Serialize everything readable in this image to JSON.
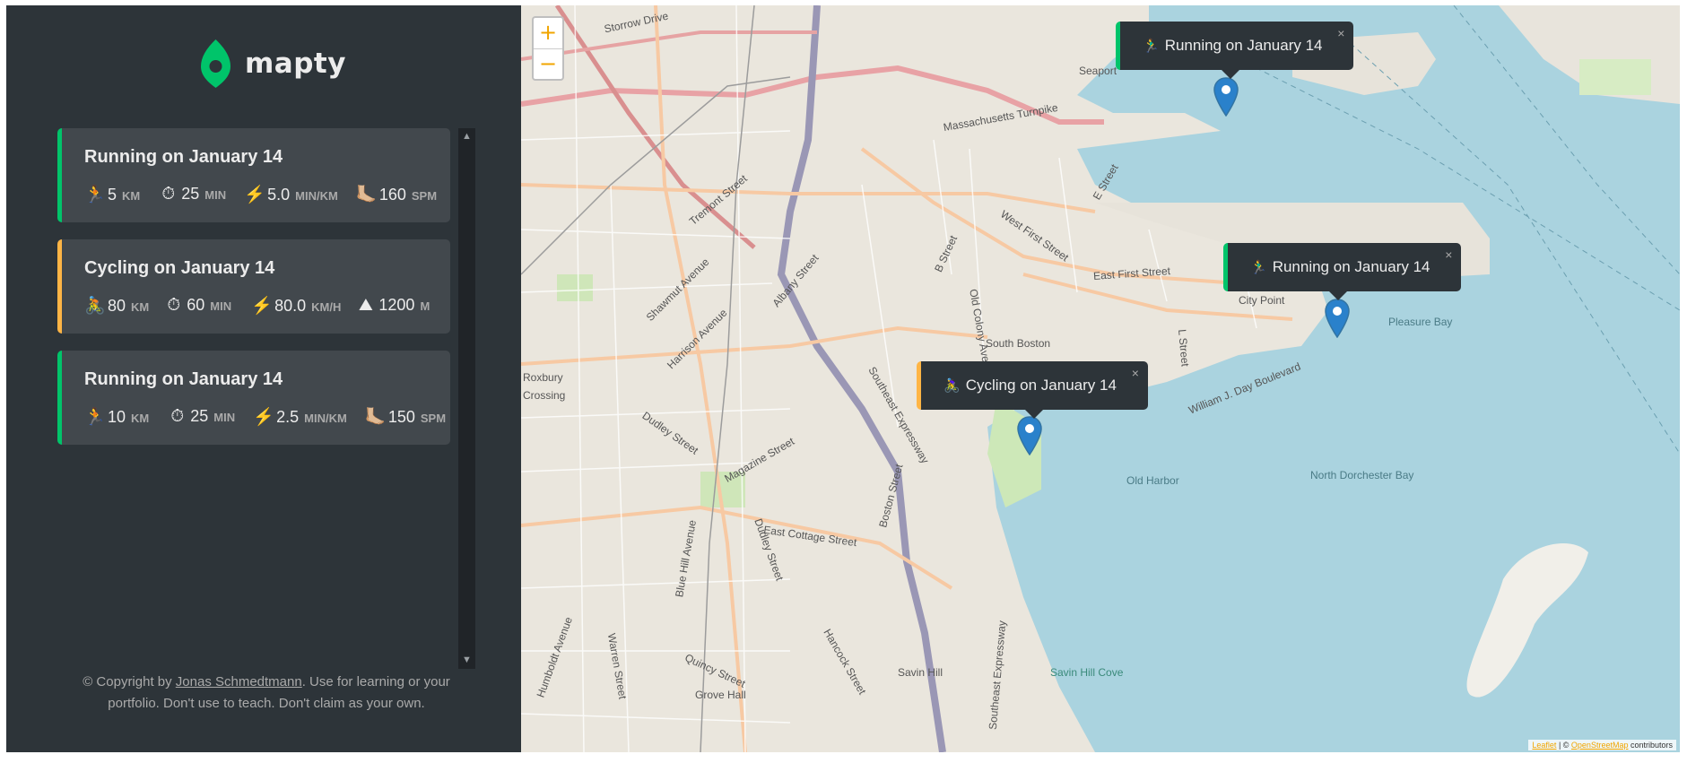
{
  "brand": {
    "name": "mapty",
    "accent": "#00c46a"
  },
  "colors": {
    "running": "#00c46a",
    "cycling": "#ffb545",
    "sidebar": "#2d3439",
    "card": "#42484d"
  },
  "workouts": [
    {
      "type": "running",
      "title": "Running on January 14",
      "stats": [
        {
          "icon": "🏃",
          "value": "5",
          "unit": "km"
        },
        {
          "icon": "⏱",
          "value": "25",
          "unit": "min"
        },
        {
          "icon": "⚡️",
          "value": "5.0",
          "unit": "min/km"
        },
        {
          "icon": "🦶🏼",
          "value": "160",
          "unit": "spm"
        }
      ]
    },
    {
      "type": "cycling",
      "title": "Cycling on January 14",
      "stats": [
        {
          "icon": "🚴",
          "value": "80",
          "unit": "km"
        },
        {
          "icon": "⏱",
          "value": "60",
          "unit": "min"
        },
        {
          "icon": "⚡️",
          "value": "80.0",
          "unit": "km/h"
        },
        {
          "icon": "⛰",
          "value": "1200",
          "unit": "m"
        }
      ]
    },
    {
      "type": "running",
      "title": "Running on January 14",
      "stats": [
        {
          "icon": "🏃",
          "value": "10",
          "unit": "km"
        },
        {
          "icon": "⏱",
          "value": "25",
          "unit": "min"
        },
        {
          "icon": "⚡️",
          "value": "2.5",
          "unit": "min/km"
        },
        {
          "icon": "🦶🏼",
          "value": "150",
          "unit": "spm"
        }
      ]
    }
  ],
  "footer": {
    "prefix": "© Copyright by ",
    "author": "Jonas Schmedtmann",
    "suffix": ". Use for learning or your portfolio. Don't use to teach. Don't claim as your own."
  },
  "map": {
    "zoom_in": "+",
    "zoom_out": "−",
    "popups": [
      {
        "type": "running",
        "icon": "🏃‍♂️",
        "text": "Running on January 14",
        "close": "×"
      },
      {
        "type": "running",
        "icon": "🏃‍♂️",
        "text": "Running on January 14",
        "close": "×"
      },
      {
        "type": "cycling",
        "icon": "🚴‍♀️",
        "text": "Cycling on January 14",
        "close": "×"
      }
    ],
    "labels": [
      "Storrow Drive",
      "Massachusetts Turnpike",
      "Seaport",
      "Tremont Street",
      "Shawmut Avenue",
      "Albany Street",
      "Harrison Avenue",
      "West First Street",
      "E Street",
      "B Street",
      "East First Street",
      "City Point",
      "Pleasure Bay",
      "South Boston",
      "Old Colony Ave",
      "L Street",
      "William J. Day Boulevard",
      "Southeast Expressway",
      "Dudley Street",
      "Magazine Street",
      "Boston Street",
      "Old Harbor",
      "North Dorchester Bay",
      "East Cottage Street",
      "Blue Hill Avenue",
      "Dudley Street",
      "Humboldt Avenue",
      "Warren Street",
      "Quincy Street",
      "Hancock Street",
      "Grove Hall",
      "Savin Hill",
      "Savin Hill Cove",
      "Southeast Expressway",
      "Roxbury",
      "Crossing"
    ],
    "attribution": {
      "leaflet": "Leaflet",
      "sep": " | © ",
      "osm": "OpenStreetMap",
      "suffix": " contributors"
    }
  }
}
